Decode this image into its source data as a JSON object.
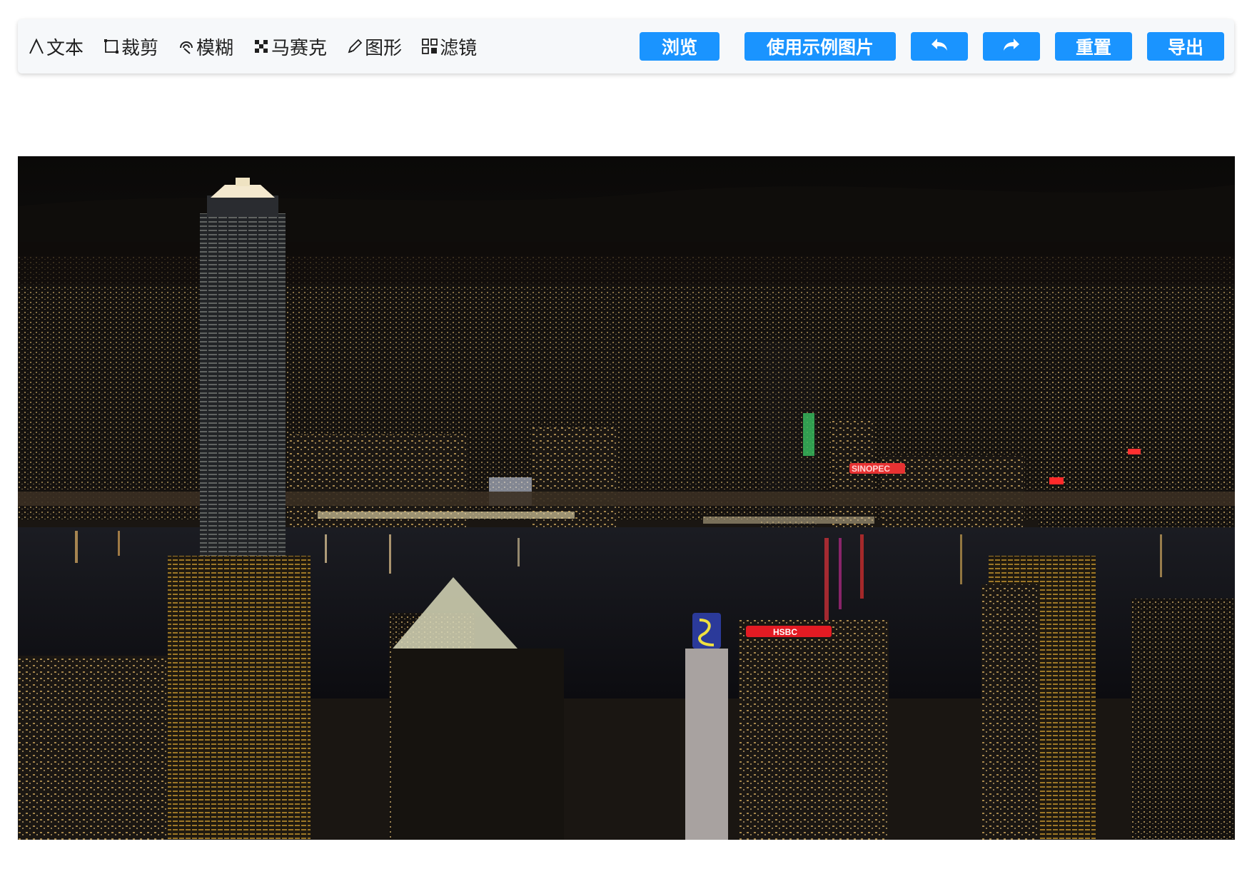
{
  "toolbar": {
    "tools": [
      {
        "label": "文本",
        "icon": "text-icon"
      },
      {
        "label": "裁剪",
        "icon": "crop-icon"
      },
      {
        "label": "模糊",
        "icon": "blur-icon"
      },
      {
        "label": "马赛克",
        "icon": "mosaic-icon"
      },
      {
        "label": "图形",
        "icon": "pencil-icon"
      },
      {
        "label": "滤镜",
        "icon": "filter-icon"
      }
    ],
    "actions": {
      "browse": "浏览",
      "sample": "使用示例图片",
      "undo_icon": "undo-icon",
      "redo_icon": "redo-icon",
      "reset": "重置",
      "export": "导出"
    },
    "accent_color": "#1a94ff"
  },
  "canvas": {
    "image_subject": "night city skyline photo",
    "signs": {
      "sinopec": "SINOPEC",
      "hsbc": "HSBC"
    }
  }
}
